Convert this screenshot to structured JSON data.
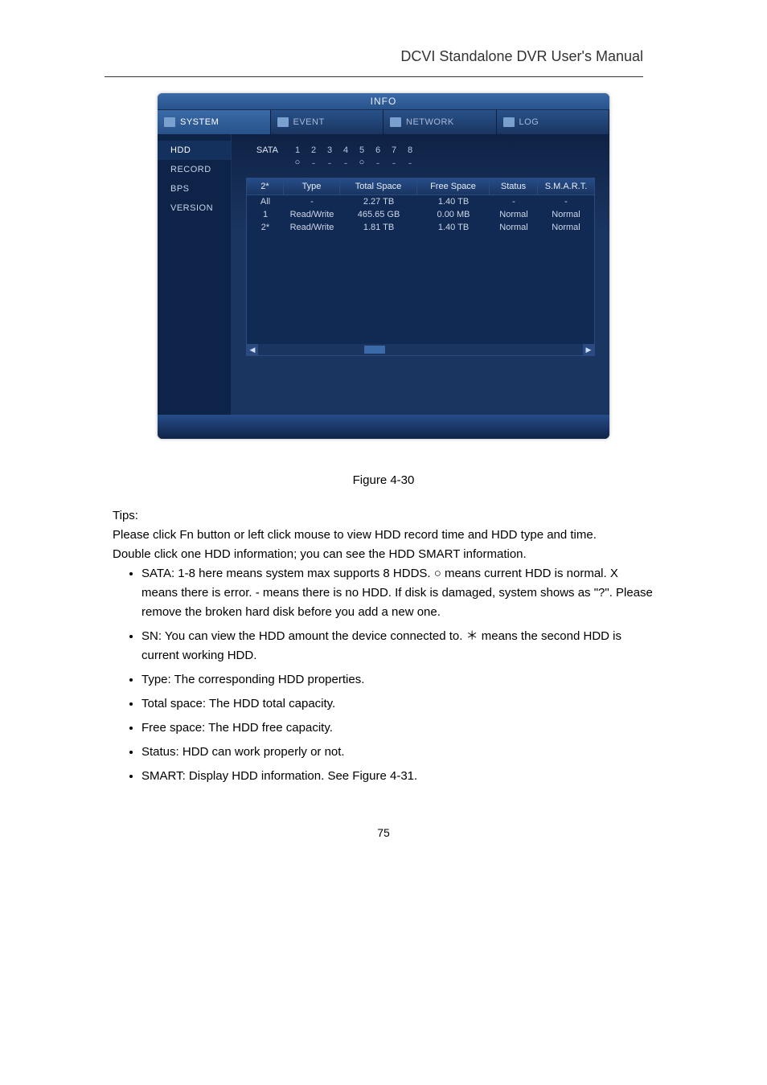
{
  "page": {
    "header": "DCVI Standalone DVR User's Manual",
    "fig_caption": "Figure 4-30",
    "body_lines": [
      "Tips:",
      "Please click Fn button or left click mouse to view HDD record time and HDD type and time.",
      "Double click one HDD information; you can see the HDD SMART information."
    ],
    "bullets": [
      "SATA: 1-8 here means system max supports 8 HDDS. ○ means current HDD is normal. X means there is error. - means there is no HDD. If disk is damaged, system shows as \"?\". Please remove the broken hard disk before you add a new one.",
      "SN: You can view the HDD amount the device connected to. ＊ means the second HDD is current working HDD.",
      "Type: The corresponding HDD properties.",
      "Total space: The HDD total capacity.",
      "Free space: The HDD free capacity.",
      "Status: HDD can work properly or not.",
      "SMART: Display HDD information. See Figure 4-31."
    ],
    "page_number": "75"
  },
  "dvr": {
    "title": "INFO",
    "tabs": [
      "SYSTEM",
      "EVENT",
      "NETWORK",
      "LOG"
    ],
    "side_items": [
      "HDD",
      "RECORD",
      "BPS",
      "VERSION"
    ],
    "sata_label": "SATA",
    "sata_count": 8,
    "hdd_table": {
      "headers": [
        "2*",
        "Type",
        "Total Space",
        "Free Space",
        "Status",
        "S.M.A.R.T."
      ],
      "rows": [
        [
          "All",
          "-",
          "2.27 TB",
          "1.40 TB",
          "-",
          "-"
        ],
        [
          "1",
          "Read/Write",
          "465.65 GB",
          "0.00 MB",
          "Normal",
          "Normal"
        ],
        [
          "2*",
          "Read/Write",
          "1.81 TB",
          "1.40 TB",
          "Normal",
          "Normal"
        ]
      ]
    }
  }
}
